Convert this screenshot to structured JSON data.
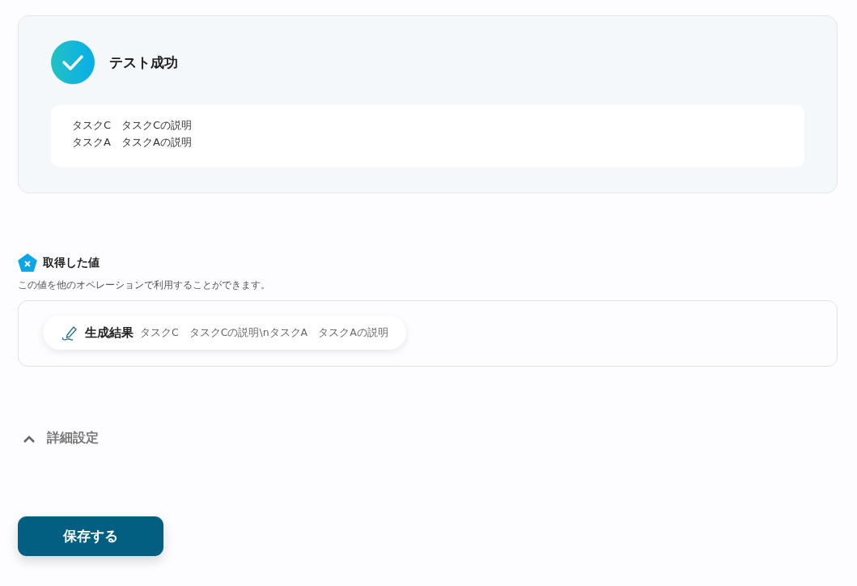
{
  "test_result": {
    "succeeded": true,
    "title": "テスト成功",
    "lines": [
      "タスクC　タスクCの説明",
      "タスクA　タスクAの説明"
    ]
  },
  "obtained_values": {
    "title": "取得した値",
    "description": "この値を他のオペレーションで利用することができます。",
    "items": [
      {
        "label": "生成結果",
        "value": "タスクC　タスクCの説明\\nタスクA　タスクAの説明"
      }
    ]
  },
  "advanced": {
    "label": "詳細設定",
    "expanded": true
  },
  "save_button": "保存する"
}
